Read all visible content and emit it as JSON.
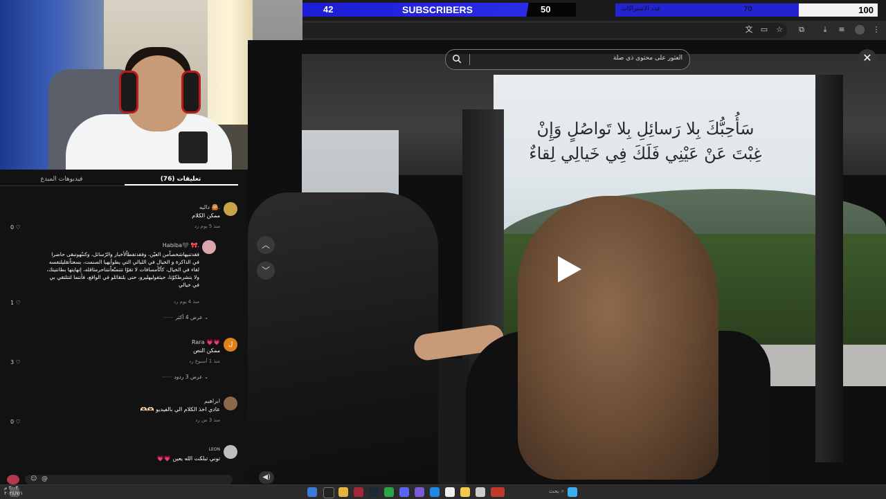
{
  "subscriber_bar": {
    "count_current": "42",
    "label": "SUBSCRIBERS",
    "count_target": "50",
    "right_caption": "عدد الاشتراكات",
    "right_current": "70",
    "right_goal": "100",
    "right_progress": 0.7,
    "color_primary": "#2323cf"
  },
  "panel": {
    "tab_videos": "فيديوهات المبدع",
    "tab_comments": "(76) تعليقات"
  },
  "comments": [
    {
      "name": "داليه 🙆🏼.",
      "text": "ممكن الكلام",
      "meta": "منذ 5 يوم   رد",
      "likes": "0"
    },
    {
      "name": "Habiba🖤 🎀.",
      "text": "فقدتنيهاشخصاًمن العيّن، وفقدتفطاًلأخبار والرّسائل، وكنتُهوتبقى حاضرا في الذاكرة و الخيال في الليالي التي يطوأيهيا الصنمت، بسعتاًتقليلنفسه لقاء في الخيال، كأنّأمسافات لا تقوّا تتنمنّعاًنتناحرمثاقله، إتهايتها بطانتيتك، ولا يتشرطكوّتا، حيثفوليهليرو، حتى بلتقائلو في الواقع، فأنتما لتتلتقي بي في خيالي",
      "meta": "منذ 4 يوم   رد",
      "likes": "1",
      "replies": "عرض 4 أكثر"
    },
    {
      "name": "Rara 💗💗",
      "text": "ممكن النص",
      "meta": "منذ 1 أسبوع   رد",
      "likes": "3",
      "replies": "عرض 3 ردود",
      "avatar_letter": "ل"
    },
    {
      "name": "ابراهيم",
      "text": "عادي اخذ الكلام الي بالفيديو 🫶🏻🫶🏻",
      "meta": "منذ 3 س   رد",
      "likes": "0"
    },
    {
      "name": "LEON",
      "text": "توني تبلكت الله يعين 💗💗",
      "meta": "",
      "likes": ""
    }
  ],
  "video": {
    "search_placeholder": "العثور على محتوى ذي صلة",
    "verse_line1": "سَأُحِبُّكَ بِلا رَسائِلِ بِلا تَواصُلٍ وَإِنْ",
    "verse_line2": "غِبْتَ عَنْ عَيْنِي فَلَكَ فِي خَيالِي لِقاءٌ",
    "close_glyph": "✕"
  },
  "taskbar": {
    "search_label": "بحث",
    "time": "٣:٠٣ م",
    "date": "٢٠٢٤/٧/١"
  }
}
